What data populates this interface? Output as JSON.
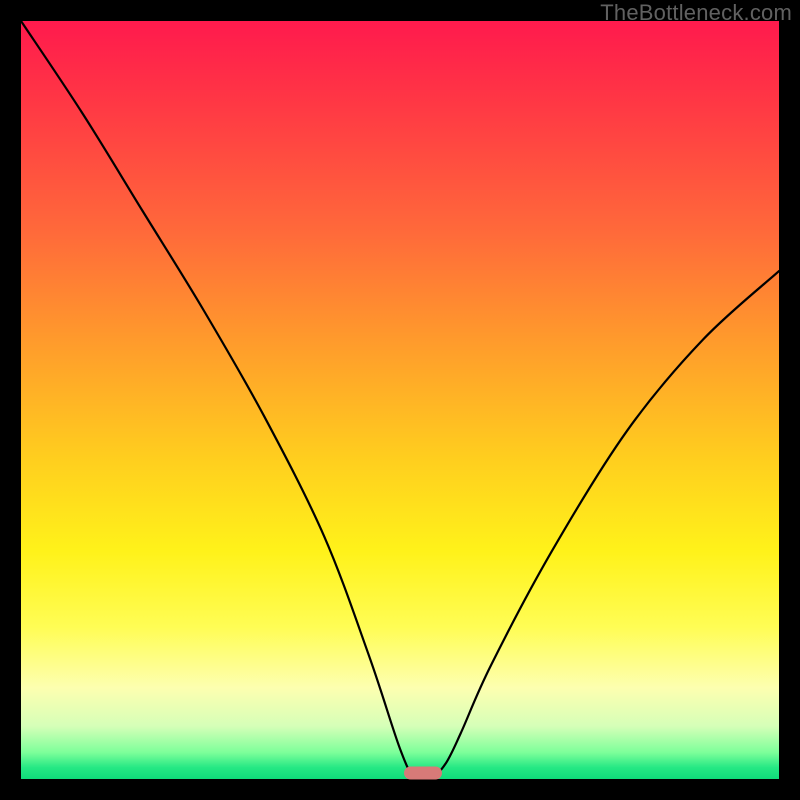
{
  "watermark": "TheBottleneck.com",
  "chart_data": {
    "type": "line",
    "title": "",
    "xlabel": "",
    "ylabel": "",
    "xlim": [
      0,
      100
    ],
    "ylim": [
      0,
      100
    ],
    "grid": false,
    "legend": false,
    "series": [
      {
        "name": "bottleneck-curve",
        "x": [
          0,
          8,
          16,
          24,
          32,
          40,
          46,
          50,
          52,
          54,
          56,
          58,
          62,
          70,
          80,
          90,
          100
        ],
        "values": [
          100,
          88,
          75,
          62,
          48,
          32,
          16,
          4,
          0,
          0,
          2,
          6,
          15,
          30,
          46,
          58,
          67
        ]
      }
    ],
    "valley_marker": {
      "x": 53,
      "y": 0.8,
      "color": "#d77a78"
    },
    "background_gradient": {
      "stops": [
        {
          "pos": 0.0,
          "color": "#ff1a4d"
        },
        {
          "pos": 0.28,
          "color": "#ff6a3a"
        },
        {
          "pos": 0.58,
          "color": "#ffcf1e"
        },
        {
          "pos": 0.8,
          "color": "#fffd55"
        },
        {
          "pos": 0.93,
          "color": "#d6ffb8"
        },
        {
          "pos": 1.0,
          "color": "#0fdc7a"
        }
      ]
    }
  }
}
